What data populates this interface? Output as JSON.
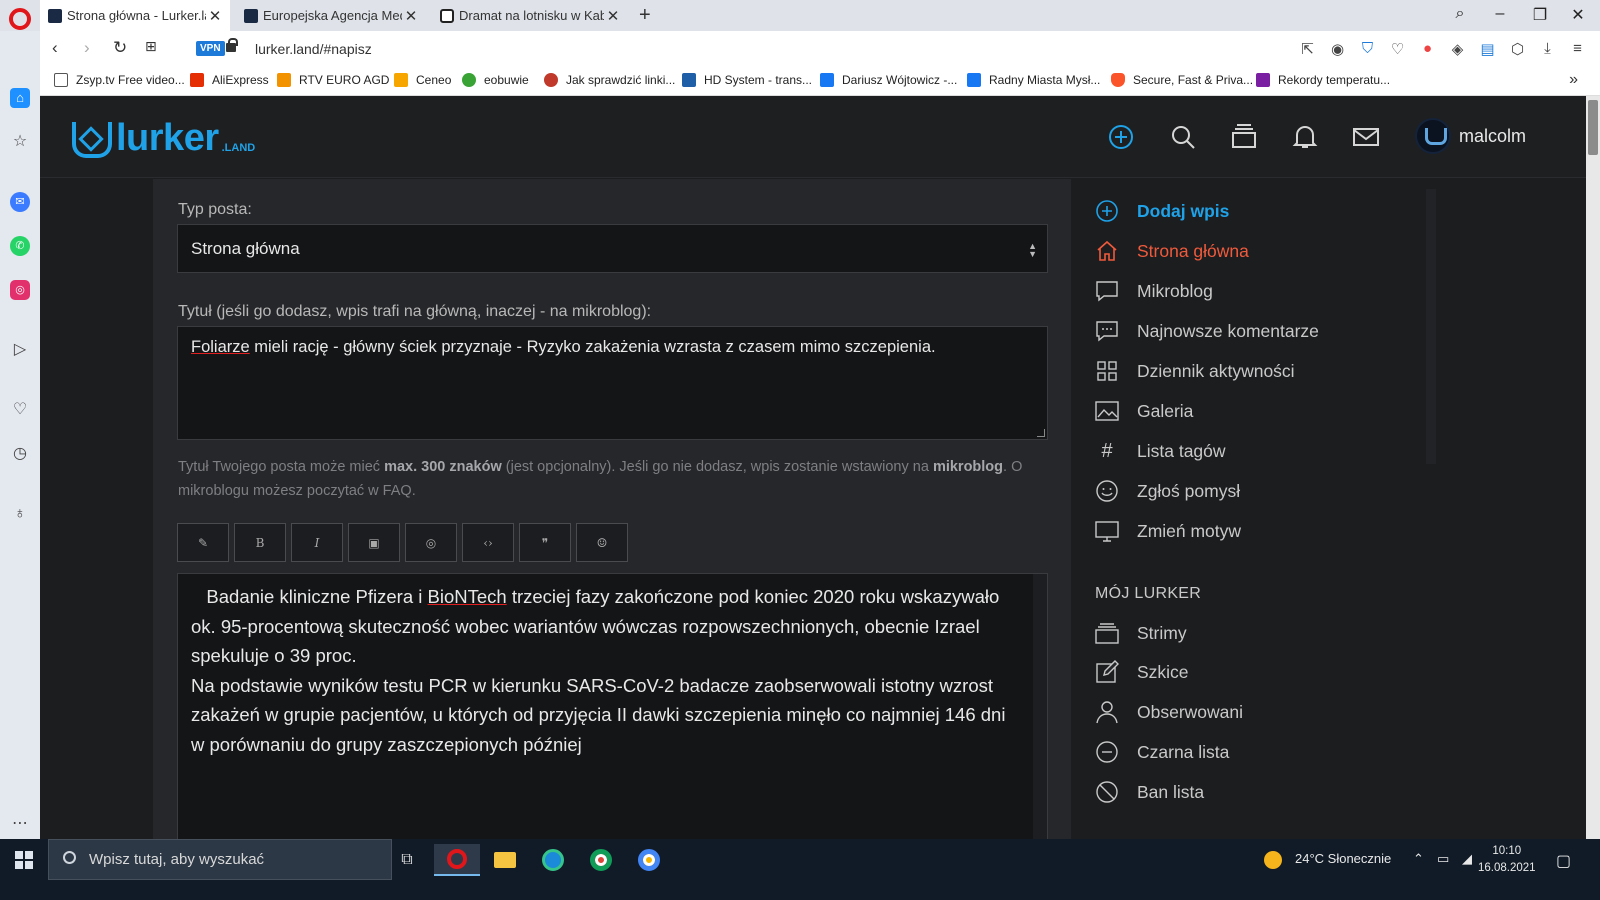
{
  "browser": {
    "tabs": [
      {
        "title": "Strona główna - Lurker.land",
        "active": true
      },
      {
        "title": "Europejska Agencja Medyczna",
        "active": false
      },
      {
        "title": "Dramat na lotnisku w Kabulu",
        "active": false
      }
    ],
    "url": "lurker.land/#napisz",
    "vpn_label": "VPN",
    "bookmarks": [
      "Zsyp.tv Free video...",
      "AliExpress",
      "RTV EURO AGD",
      "Ceneo",
      "eobuwie",
      "Jak sprawdzić linki...",
      "HD System - trans...",
      "Dariusz Wójtowicz -...",
      "Radny Miasta Mysł...",
      "Secure, Fast & Priva...",
      "Rekordy temperatu..."
    ]
  },
  "site": {
    "logo_text": "lurker",
    "logo_sub": ".LAND",
    "username": "malcolm"
  },
  "form": {
    "post_type_label": "Typ posta:",
    "post_type_value": "Strona główna",
    "title_label": "Tytuł (jeśli go dodasz, wpis trafi na główną, inaczej - na mikroblog):",
    "title_word_misspelled": "Foliarze",
    "title_rest": " mieli rację  - główny ściek przyznaje - Ryzyko zakażenia wzrasta z czasem mimo szczepienia.",
    "hint_part1": "Tytuł Twojego posta może mieć ",
    "hint_bold1": "max. 300 znaków",
    "hint_part2": " (jest opcjonalny). Jeśli go nie dodasz, wpis zostanie wstawiony na ",
    "hint_bold2": "mikroblog",
    "hint_part3": ". O mikroblogu możesz poczytać w FAQ.",
    "toolbar": [
      "✎",
      "B",
      "I",
      "▣",
      "◎",
      "‹›",
      "❞",
      "☺"
    ],
    "body_l1_a": "   Badanie kliniczne Pfizera i ",
    "body_l1_sp": "BioNTech",
    "body_l1_b": " trzeciej fazy zakończone pod koniec 2020 roku wskazywało ok. 95-procentową skuteczność wobec wariantów wówczas rozpowszechnionych, obecnie Izrael spekuluje o 39 proc.",
    "body_l2": "Na podstawie wyników testu PCR w kierunku SARS-CoV-2 badacze zaobserwowali istotny wzrost zakażeń w grupie pacjentów, u których od przyjęcia II dawki szczepienia minęło co najmniej 146 dni w porównaniu do grupy zaszczepionych później"
  },
  "menu": {
    "items": [
      {
        "label": "Dodaj wpis",
        "icon": "plus-circle-icon"
      },
      {
        "label": "Strona główna",
        "icon": "home-icon"
      },
      {
        "label": "Mikroblog",
        "icon": "chat-bubble-icon"
      },
      {
        "label": "Najnowsze komentarze",
        "icon": "comments-icon"
      },
      {
        "label": "Dziennik aktywności",
        "icon": "grid-icon"
      },
      {
        "label": "Galeria",
        "icon": "image-icon"
      },
      {
        "label": "Lista tagów",
        "icon": "hash-icon"
      },
      {
        "label": "Zgłoś pomysł",
        "icon": "smile-icon"
      },
      {
        "label": "Zmień motyw",
        "icon": "monitor-icon"
      }
    ],
    "section_heading": "MÓJ LURKER",
    "my_items": [
      {
        "label": "Strimy",
        "icon": "layers-icon"
      },
      {
        "label": "Szkice",
        "icon": "edit-icon"
      },
      {
        "label": "Obserwowani",
        "icon": "user-icon"
      },
      {
        "label": "Czarna lista",
        "icon": "minus-circle-icon"
      },
      {
        "label": "Ban lista",
        "icon": "ban-icon"
      }
    ]
  },
  "taskbar": {
    "search_placeholder": "Wpisz tutaj, aby wyszukać",
    "weather": "24°C  Słonecznie",
    "time": "10:10",
    "date": "16.08.2021"
  },
  "colors": {
    "accent": "#1fa2e8",
    "home": "#f05a3c",
    "bg": "#1c1d1f",
    "panel": "#26272a"
  }
}
